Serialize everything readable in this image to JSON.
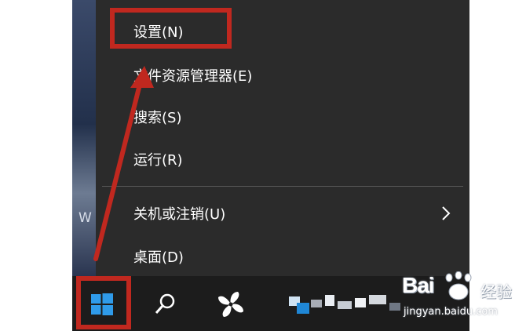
{
  "desktop": {
    "partial_text": "W"
  },
  "context_menu": {
    "items": [
      {
        "label": "设置(N)"
      },
      {
        "label": "文件资源管理器(E)"
      },
      {
        "label": "搜索(S)"
      },
      {
        "label": "运行(R)"
      },
      {
        "label": "关机或注销(U)",
        "has_submenu": true
      },
      {
        "label": "桌面(D)"
      }
    ]
  },
  "taskbar": {
    "icons": [
      "windows-start-icon",
      "search-icon",
      "pinwheel-app-icon"
    ]
  },
  "annotation": {
    "color": "#c0281f"
  },
  "watermark": {
    "logo": "Bai",
    "brand_suffix": "经验",
    "url": "jingyan.baidu.com"
  }
}
